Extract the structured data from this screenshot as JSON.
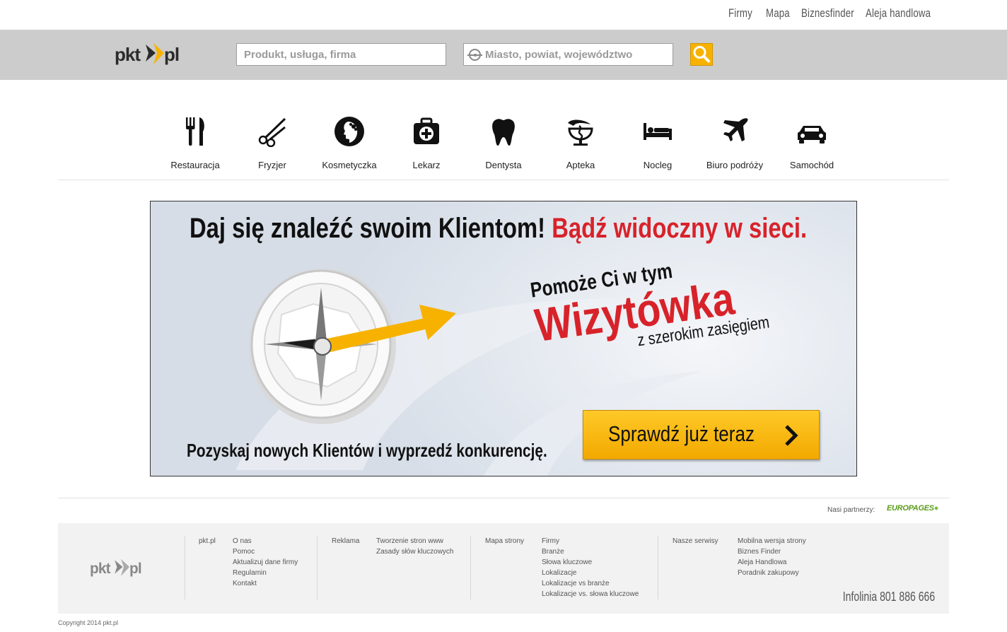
{
  "topnav": {
    "items": [
      "Firmy",
      "Mapa",
      "Biznesfinder",
      "Aleja handlowa"
    ]
  },
  "search": {
    "what_placeholder": "Produkt, usługa, firma",
    "where_placeholder": "Miasto, powiat, województwo",
    "button_icon": "search-icon"
  },
  "logo": {
    "text": "pkt.pl"
  },
  "categories": [
    {
      "label": "Restauracja",
      "icon": "fork-knife-icon"
    },
    {
      "label": "Fryzjer",
      "icon": "scissors-icon"
    },
    {
      "label": "Kosmetyczka",
      "icon": "beauty-face-icon"
    },
    {
      "label": "Lekarz",
      "icon": "medical-kit-icon"
    },
    {
      "label": "Dentysta",
      "icon": "tooth-icon"
    },
    {
      "label": "Apteka",
      "icon": "pharmacy-icon"
    },
    {
      "label": "Nocleg",
      "icon": "bed-icon"
    },
    {
      "label": "Biuro podróży",
      "icon": "airplane-icon"
    },
    {
      "label": "Samochód",
      "icon": "car-icon"
    }
  ],
  "banner": {
    "headline": "Daj się znaleźć swoim Klientom!",
    "headline_red": "Bądź widoczny w sieci.",
    "promo_line1": "Pomoże Ci w tym",
    "promo_line2": "Wizytówka",
    "promo_line3": "z szerokim zasięgiem",
    "cta": "Sprawdź już teraz",
    "bottom_line": "Pozyskaj nowych Klientów i wyprzedź konkurencję."
  },
  "partners": {
    "label": "Nasi partnerzy:",
    "name": "EUROPAGES"
  },
  "footer": {
    "columns": [
      {
        "title": "pkt.pl",
        "links": [
          "O nas",
          "Pomoc",
          "Aktualizuj dane firmy",
          "Regulamin",
          "Kontakt"
        ]
      },
      {
        "title": "Reklama",
        "links": [
          "Tworzenie stron www",
          "Zasady słów kluczowych"
        ]
      },
      {
        "title": "Mapa strony",
        "links": [
          "Firmy",
          "Branże",
          "Słowa kluczowe",
          "Lokalizacje",
          "Lokalizacje vs branże",
          "Lokalizacje vs. słowa kluczowe"
        ]
      },
      {
        "title": "Nasze serwisy",
        "links": [
          "Mobilna wersja strony",
          "Biznes Finder",
          "Aleja Handlowa",
          "Poradnik zakupowy"
        ]
      }
    ],
    "infoline": "Infolinia 801 886 666",
    "copyright": "Copyright 2014 pkt.pl"
  },
  "colors": {
    "accent": "#f7b200",
    "red": "#d8222a",
    "bar": "#cccccc"
  }
}
